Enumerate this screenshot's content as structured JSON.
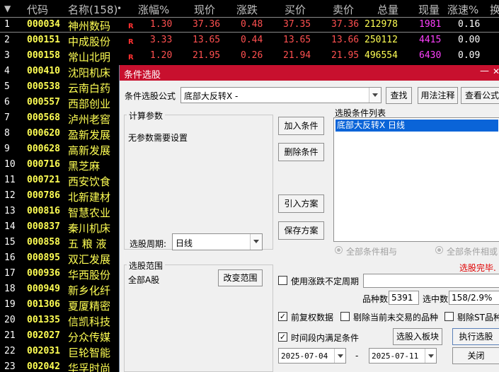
{
  "grid": {
    "headers": {
      "sort_arrow": "▼",
      "code": "代码",
      "name": "名称(158)",
      "name_dot": "•",
      "pct": "涨幅%",
      "price": "现价",
      "change": "涨跌",
      "bid": "买价",
      "ask": "卖价",
      "volume": "总量",
      "cur_vol": "现量",
      "speed": "涨速%",
      "turnover": "换"
    },
    "rows": [
      {
        "idx": "1",
        "code": "000034",
        "name": "神州数码",
        "r": "R",
        "pct": "1.30",
        "price": "37.36",
        "change": "0.48",
        "bid": "37.35",
        "ask": "37.36",
        "vol": "212978",
        "cur": "1981",
        "speed": "0.16"
      },
      {
        "idx": "2",
        "code": "000151",
        "name": "中成股份",
        "r": "R",
        "pct": "3.33",
        "price": "13.65",
        "change": "0.44",
        "bid": "13.65",
        "ask": "13.66",
        "vol": "250112",
        "cur": "4415",
        "speed": "0.00"
      },
      {
        "idx": "3",
        "code": "000158",
        "name": "常山北明",
        "r": "R",
        "pct": "1.20",
        "price": "21.95",
        "change": "0.26",
        "bid": "21.94",
        "ask": "21.95",
        "vol": "496554",
        "cur": "6430",
        "speed": "0.09"
      },
      {
        "idx": "4",
        "code": "000410",
        "name": "沈阳机床"
      },
      {
        "idx": "5",
        "code": "000538",
        "name": "云南白药"
      },
      {
        "idx": "6",
        "code": "000557",
        "name": "西部创业"
      },
      {
        "idx": "7",
        "code": "000568",
        "name": "泸州老窖"
      },
      {
        "idx": "8",
        "code": "000620",
        "name": "盈新发展"
      },
      {
        "idx": "9",
        "code": "000628",
        "name": "高新发展"
      },
      {
        "idx": "10",
        "code": "000716",
        "name": "黑芝麻"
      },
      {
        "idx": "11",
        "code": "000721",
        "name": "西安饮食"
      },
      {
        "idx": "12",
        "code": "000786",
        "name": "北新建材"
      },
      {
        "idx": "13",
        "code": "000816",
        "name": "智慧农业"
      },
      {
        "idx": "14",
        "code": "000837",
        "name": "秦川机床"
      },
      {
        "idx": "15",
        "code": "000858",
        "name": "五 粮 液"
      },
      {
        "idx": "16",
        "code": "000895",
        "name": "双汇发展"
      },
      {
        "idx": "17",
        "code": "000936",
        "name": "华西股份"
      },
      {
        "idx": "18",
        "code": "000949",
        "name": "新乡化纤"
      },
      {
        "idx": "19",
        "code": "001306",
        "name": "夏厦精密"
      },
      {
        "idx": "20",
        "code": "001335",
        "name": "信凯科技"
      },
      {
        "idx": "21",
        "code": "002027",
        "name": "分众传媒"
      },
      {
        "idx": "22",
        "code": "002031",
        "name": "巨轮智能"
      },
      {
        "idx": "23",
        "code": "002042",
        "name": "华孚时尚"
      }
    ]
  },
  "dialog": {
    "title": "条件选股",
    "min_glyph": "—",
    "close_glyph": "✕",
    "formula_label": "条件选股公式",
    "formula_value": "底部大反转X  -",
    "find_button": "查找",
    "usage_button": "用法注释",
    "view_button": "查看公式",
    "params_group": "计算参数",
    "params_text": "无参数需要设置",
    "period_label": "选股周期:",
    "period_value": "日线",
    "add_button": "加入条件",
    "delete_button": "删除条件",
    "import_button": "引入方案",
    "save_button": "保存方案",
    "cond_list_label": "选股条件列表",
    "cond_list_items": [
      "底部大反转X  日线"
    ],
    "radio_and": "全部条件相与",
    "radio_or": "全部条件相或",
    "status": "选股完毕.",
    "scope_group": "选股范围",
    "scope_value": "全部A股",
    "change_scope_button": "改变范围",
    "use_uncertain_label": "使用涨跌不定周期",
    "use_uncertain_checked": false,
    "count_label": "品种数",
    "count_value": "5391",
    "selected_label": "选中数",
    "selected_value": "158/2.9%",
    "adj_label": "前复权数据",
    "adj_checked": true,
    "exclude_untraded_label": "剔除当前未交易的品种",
    "exclude_untraded_checked": false,
    "exclude_st_label": "剔除ST品种",
    "exclude_st_checked": false,
    "time_cond_label": "时间段内满足条件",
    "time_cond_checked": true,
    "to_block_button": "选股入板块",
    "run_button": "执行选股",
    "start_date": "2025-07-04",
    "date_sep": "-",
    "end_date": "2025-07-11",
    "close_button": "关闭",
    "check_glyph": "✓"
  },
  "colors": {
    "title_bar": "#c8102e",
    "grid_bg": "#000000",
    "code_yellow": "#ffff54",
    "up_red": "#ff5050",
    "volume_magenta": "#ff40ff",
    "list_selection": "#0a64d8",
    "status_red": "#e00000"
  }
}
